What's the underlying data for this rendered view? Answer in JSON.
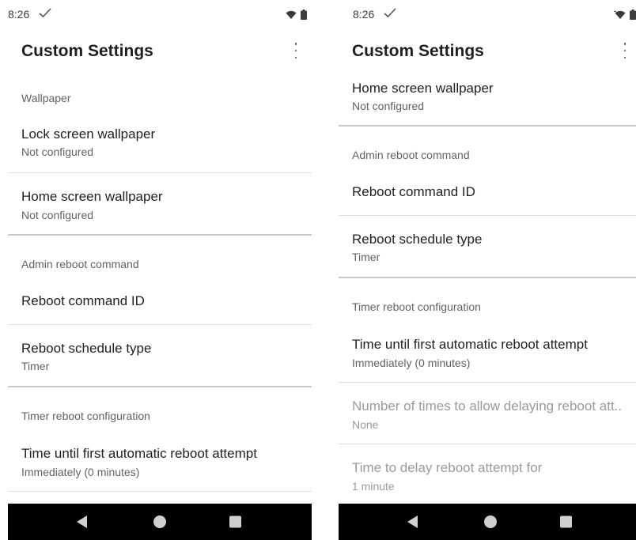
{
  "left_screen": {
    "status": {
      "time": "8:26"
    },
    "appbar": {
      "title": "Custom Settings"
    },
    "items": [
      {
        "kind": "section",
        "label": "Wallpaper"
      },
      {
        "kind": "pref",
        "title": "Lock screen wallpaper",
        "summary": "Not configured"
      },
      {
        "kind": "pref",
        "title": "Home screen wallpaper",
        "summary": "Not configured"
      },
      {
        "kind": "section",
        "label": "Admin reboot command"
      },
      {
        "kind": "pref",
        "title": "Reboot command ID",
        "summary": ""
      },
      {
        "kind": "pref",
        "title": "Reboot schedule type",
        "summary": "Timer"
      },
      {
        "kind": "section",
        "label": "Timer reboot configuration"
      },
      {
        "kind": "pref",
        "title": "Time until first automatic reboot attempt",
        "summary": "Immediately (0 minutes)"
      }
    ]
  },
  "right_screen": {
    "status": {
      "time": "8:26"
    },
    "appbar": {
      "title": "Custom Settings"
    },
    "items": [
      {
        "kind": "pref",
        "title": "Home screen wallpaper",
        "summary": "Not configured"
      },
      {
        "kind": "section",
        "label": "Admin reboot command"
      },
      {
        "kind": "pref",
        "title": "Reboot command ID",
        "summary": ""
      },
      {
        "kind": "pref",
        "title": "Reboot schedule type",
        "summary": "Timer"
      },
      {
        "kind": "section",
        "label": "Timer reboot configuration"
      },
      {
        "kind": "pref",
        "title": "Time until first automatic reboot attempt",
        "summary": "Immediately (0 minutes)"
      },
      {
        "kind": "pref",
        "title": "Number of times to allow delaying reboot att..",
        "summary": "None",
        "disabled": true
      },
      {
        "kind": "pref",
        "title": "Time to delay reboot attempt for",
        "summary": "1 minute",
        "disabled": true
      }
    ]
  },
  "icons": {
    "status_check": "check-icon",
    "wifi": "wifi-icon",
    "battery": "battery-icon",
    "overflow": "more-vert-icon",
    "nav_back": "back-icon",
    "nav_home": "home-icon",
    "nav_recents": "recents-icon"
  },
  "colors": {
    "title_text": "#1f1f1f",
    "summary_text": "#5f6368",
    "disabled_text": "#9a9a9a",
    "nav_bar": "#000000"
  }
}
